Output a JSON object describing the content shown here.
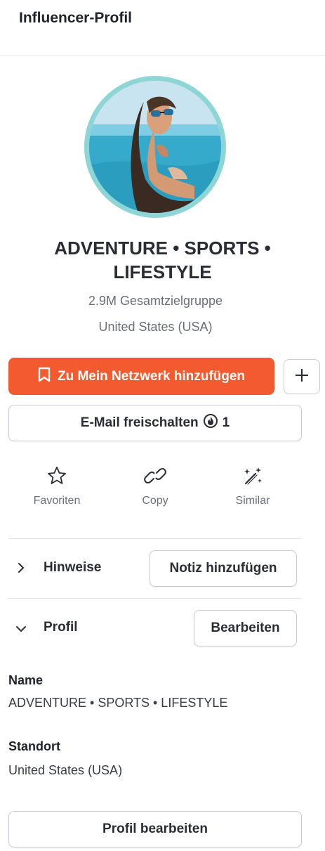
{
  "header": {
    "title": "Influencer-Profil"
  },
  "profile": {
    "avatar_alt": "profile-photo",
    "name": "ADVENTURE • SPORTS • LIFESTYLE",
    "audience": "2.9M Gesamtzielgruppe",
    "country": "United States (USA)"
  },
  "buttons": {
    "add_network": "Zu Mein Netzwerk hinzufügen",
    "unlock_email": "E-Mail freischalten",
    "unlock_credits": "1",
    "add_note": "Notiz hinzufügen",
    "edit": "Bearbeiten",
    "edit_profile": "Profil bearbeiten"
  },
  "actions": [
    {
      "label": "Favoriten",
      "icon": "star-icon"
    },
    {
      "label": "Copy",
      "icon": "link-icon"
    },
    {
      "label": "Similar",
      "icon": "magic-wand-icon"
    }
  ],
  "sections": {
    "notes": {
      "title": "Hinweise",
      "expanded": false
    },
    "profile": {
      "title": "Profil",
      "expanded": true
    }
  },
  "fields": {
    "name_label": "Name",
    "name_value": "ADVENTURE • SPORTS • LIFESTYLE",
    "location_label": "Standort",
    "location_value": "United States (USA)"
  },
  "colors": {
    "accent": "#f35a2f",
    "avatar_ring": "#8ed6d6",
    "muted_text": "#6b6f78"
  }
}
